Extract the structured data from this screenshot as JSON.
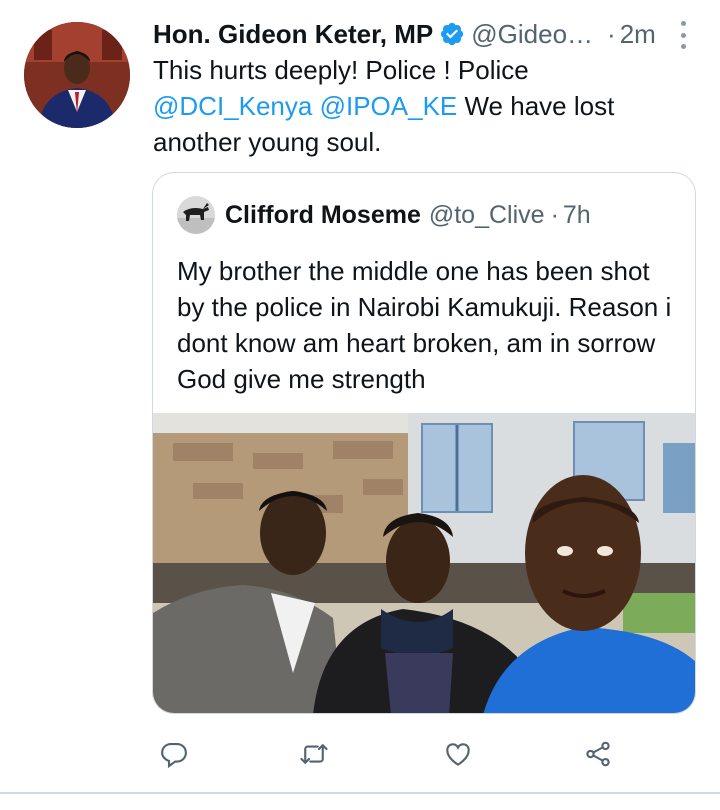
{
  "tweet": {
    "author_name": "Hon. Gideon Keter, MP",
    "author_handle": "@Gideo…",
    "separator": "·",
    "time": "2m",
    "verified": true,
    "text": {
      "part1": "This hurts deeply! Police ! Police",
      "mention1": "@DCI_Kenya",
      "mention2": "@IPOA_KE",
      "part2": " We have lost another young soul."
    }
  },
  "quote": {
    "author_name": "Clifford Moseme",
    "author_handle": "@to_Clive",
    "separator": "·",
    "time": "7h",
    "text": "My brother the middle one has been shot by the police in Nairobi Kamukuji. Reason i dont know am heart broken, am in sorrow God give me strength"
  },
  "actions": [
    "reply-icon",
    "retweet-icon",
    "like-icon",
    "share-icon"
  ],
  "colors": {
    "link": "#1d9bf0",
    "secondary_text": "#536471",
    "border": "#cfd9de",
    "icon": "#536471"
  }
}
